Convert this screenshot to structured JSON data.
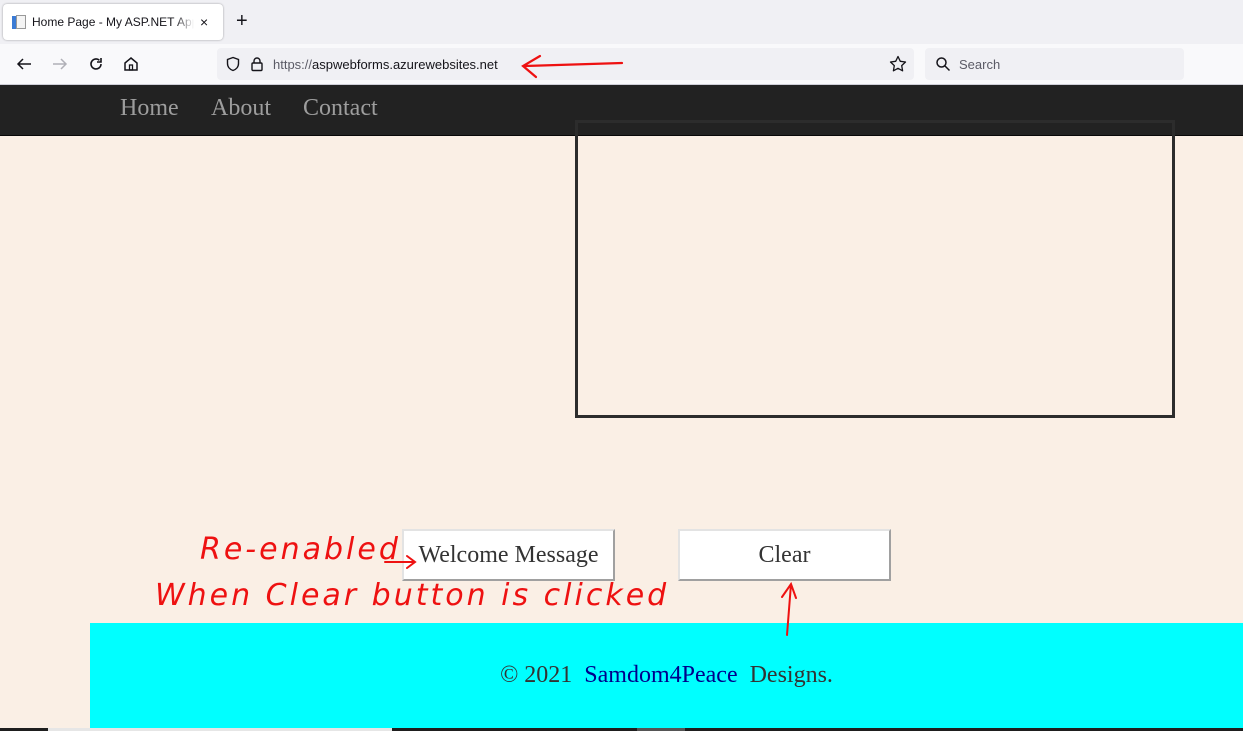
{
  "browser": {
    "tab": {
      "title": "Home Page - My ASP.NET Application",
      "close_label": "×"
    },
    "new_tab_label": "+",
    "url": {
      "scheme": "https://",
      "host": "aspwebforms.azurewebsites.net"
    },
    "search_placeholder": "Search"
  },
  "site": {
    "nav": [
      {
        "label": "Home"
      },
      {
        "label": "About"
      },
      {
        "label": "Contact"
      }
    ],
    "buttons": {
      "welcome": "Welcome Message",
      "clear": "Clear"
    },
    "footer": {
      "copyright": "© 2021",
      "brand": "Samdom4Peace",
      "suffix": "Designs."
    }
  },
  "annotations": {
    "line1": "Re-enabled",
    "line2": "When Clear button is clicked"
  },
  "colors": {
    "page_bg": "#faefe5",
    "nav_bg": "#222222",
    "footer_bg": "#00ffff",
    "brand_link": "#00008b",
    "annotation": "#ee1111"
  }
}
